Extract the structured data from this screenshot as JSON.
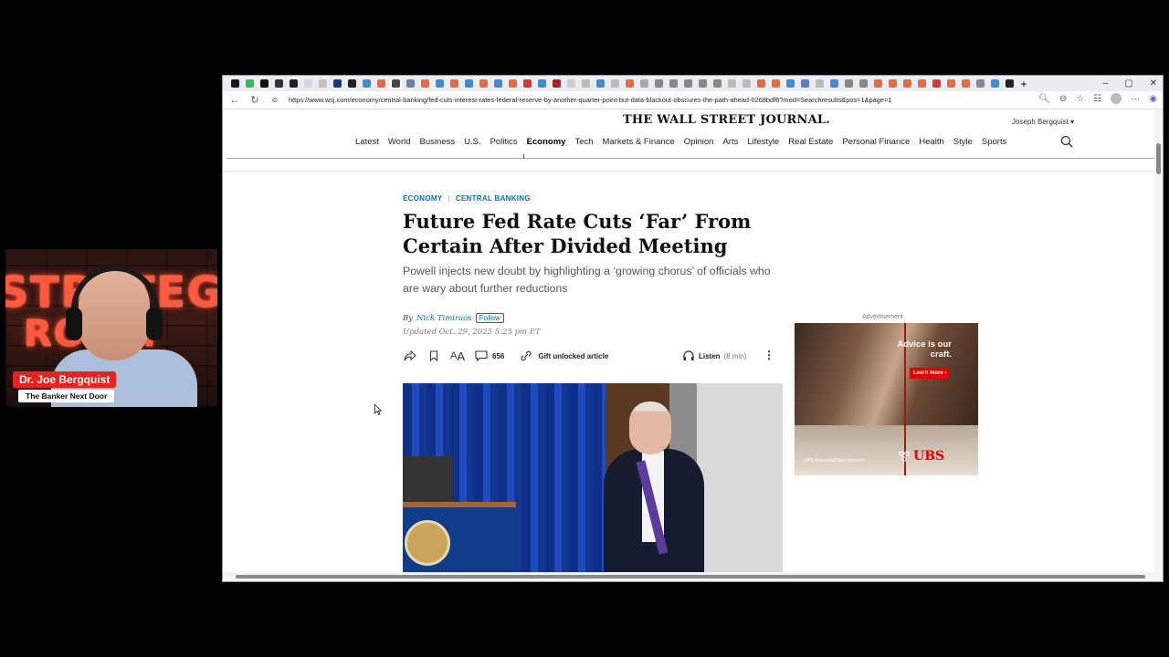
{
  "webcam": {
    "neon_text_top": "STRATEGY",
    "neon_text_bottom": "ROOM",
    "name": "Dr. Joe Bergquist",
    "subtitle": "The Banker Next Door"
  },
  "browser": {
    "url": "https://www.wsj.com/economy/central-banking/fed-cuts-interest-rates-federal-reserve-by-another-quarter-point-but-data-blackout-obscures-the-path-ahead-0268bdf6?mod=Searchresults&pos=1&page=1",
    "tab_count": 58,
    "tab_colors": [
      "#1a1a1a",
      "#2bbf5a",
      "#111",
      "#333",
      "#222",
      "#cfd6e8",
      "#c0c0c0",
      "#1b3a7a",
      "#222",
      "#3c8bd9",
      "#e86b3c",
      "#444",
      "#6a7fb0",
      "#e86b3c",
      "#3c8bd9",
      "#e86b3c",
      "#3c8bd9",
      "#e86b3c",
      "#3c8bd9",
      "#e86b3c",
      "#d33",
      "#3c8bd9",
      "#b21f1f",
      "#ccc",
      "#bbb",
      "#3c8bd9",
      "#bbb",
      "#e86b3c",
      "#aaa",
      "#888",
      "#888",
      "#888",
      "#888",
      "#888",
      "#bbb",
      "#bbb",
      "#e86b3c",
      "#e86b3c",
      "#3c8bd9",
      "#5c7bd9",
      "#bbb",
      "#3c8bd9",
      "#888",
      "#888",
      "#e86b3c",
      "#e86b3c",
      "#e86b3c",
      "#e86b3c",
      "#d33",
      "#e86b3c",
      "#e86b3c",
      "#888",
      "#3c8bd9",
      "#222"
    ]
  },
  "wsj": {
    "logo": "THE WALL STREET JOURNAL.",
    "user": "Joseph Bergquist",
    "user_caret": "▾",
    "nav": [
      "Latest",
      "World",
      "Business",
      "U.S.",
      "Politics",
      "Economy",
      "Tech",
      "Markets & Finance",
      "Opinion",
      "Arts",
      "Lifestyle",
      "Real Estate",
      "Personal Finance",
      "Health",
      "Style",
      "Sports"
    ],
    "active_nav": "Economy"
  },
  "article": {
    "section": "ECONOMY",
    "subsection": "CENTRAL BANKING",
    "headline": "Future Fed Rate Cuts ‘Far’ From Certain After Divided Meeting",
    "dek": "Powell injects new doubt by highlighting a ‘growing chorus’ of officials who are wary about further reductions",
    "by": "By",
    "author": "Nick Timiraos",
    "follow": "Follow",
    "updated": "Updated Oct. 29, 2025 5:25 pm ET",
    "comment_count": "656",
    "gift": "Gift unlocked article",
    "listen": "Listen",
    "listen_duration": "(8 min)"
  },
  "ad": {
    "label": "Advertisement",
    "headline": "Advice is our craft.",
    "cta": "Learn more ›",
    "fine_print": "UBS Financial Services Inc.",
    "logo": "UBS"
  },
  "colors": {
    "accent_blue": "#0274b6",
    "wsj_text": "#111111",
    "ubs_red": "#e60000",
    "badge_red": "#e8231d"
  }
}
